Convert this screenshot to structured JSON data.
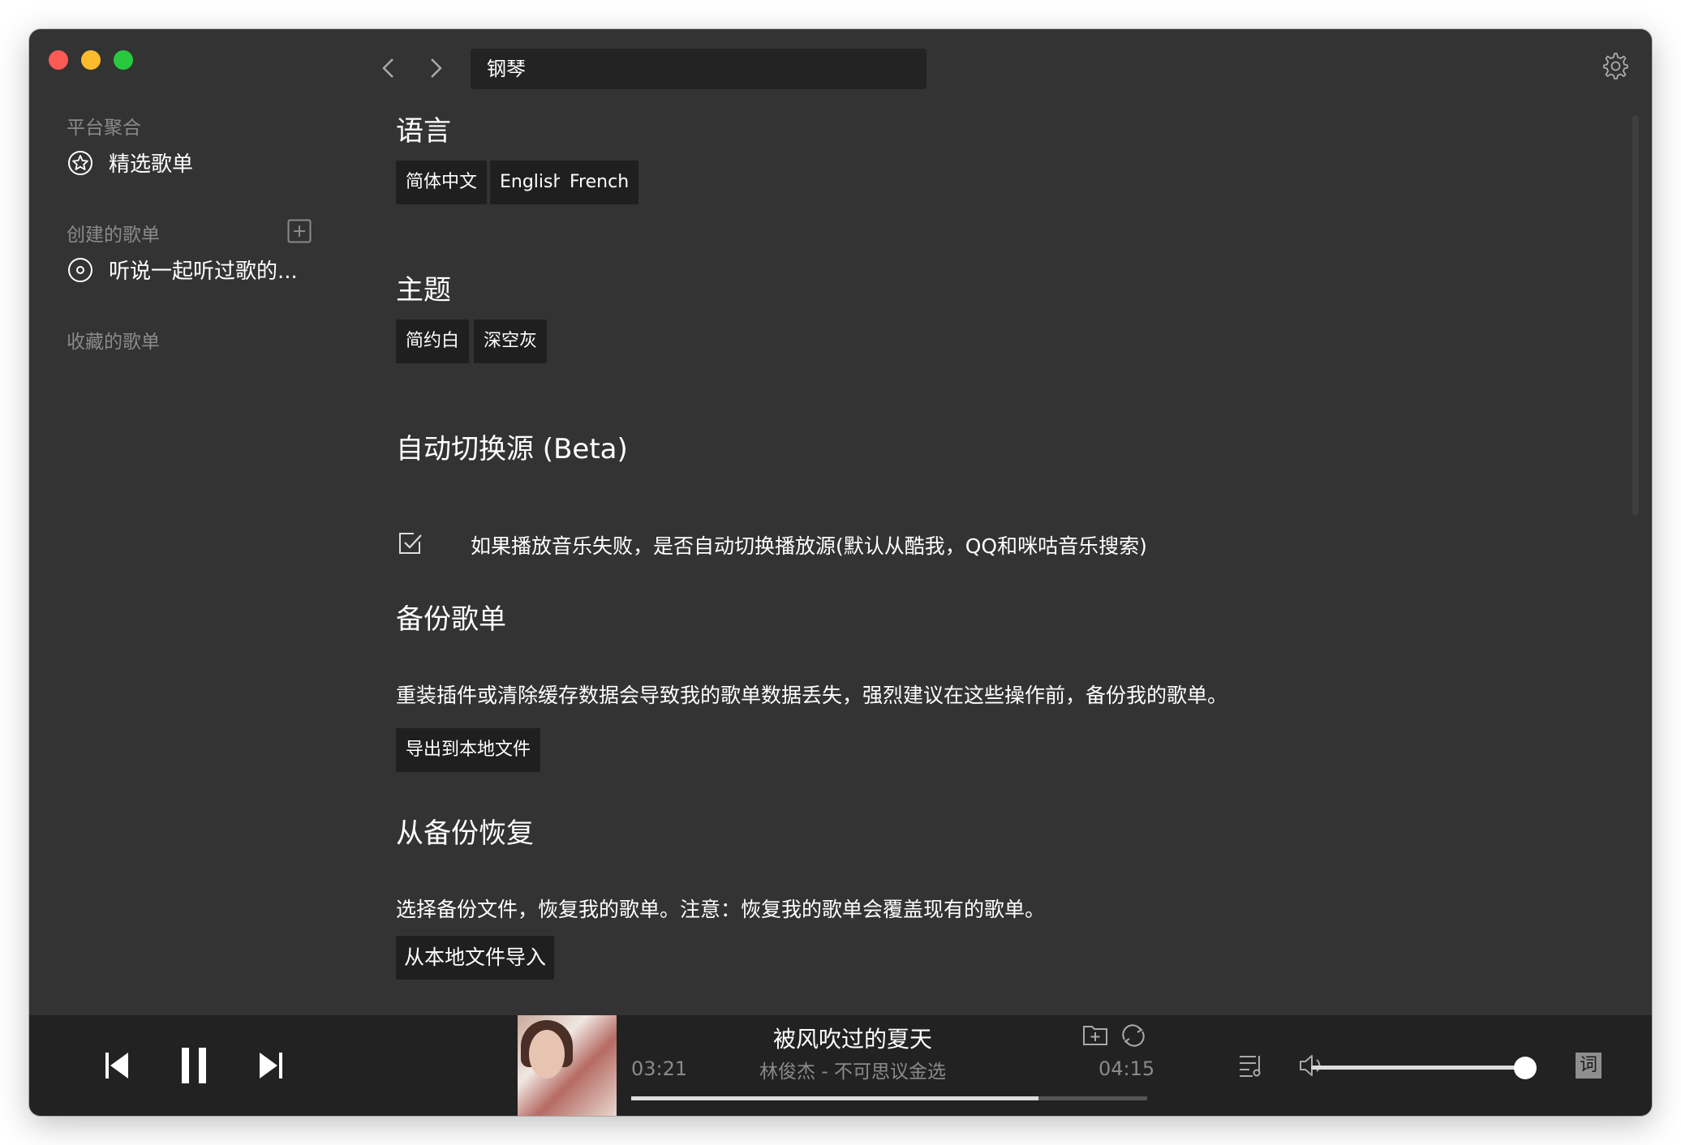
{
  "search": {
    "value": "钢琴"
  },
  "sidebar": {
    "platform_section": "平台聚合",
    "featured_label": "精选歌单",
    "created_section": "创建的歌单",
    "created_items": [
      "听说一起听过歌的..."
    ],
    "favorites_section": "收藏的歌单"
  },
  "settings": {
    "language": {
      "title": "语言",
      "options": [
        "简体中文",
        "English",
        "French"
      ]
    },
    "theme": {
      "title": "主题",
      "options": [
        "简约白",
        "深空灰"
      ]
    },
    "auto_switch": {
      "title": "自动切换源 (Beta)",
      "checkbox_label": "如果播放音乐失败，是否自动切换播放源(默认从酷我，QQ和咪咕音乐搜索)",
      "checked": true
    },
    "backup": {
      "title": "备份歌单",
      "description": "重装插件或清除缓存数据会导致我的歌单数据丢失，强烈建议在这些操作前，备份我的歌单。",
      "button": "导出到本地文件"
    },
    "restore": {
      "title": "从备份恢复",
      "description": "选择备份文件，恢复我的歌单。注意：恢复我的歌单会覆盖现有的歌单。",
      "button": "从本地文件导入"
    }
  },
  "player": {
    "title": "被风吹过的夏天",
    "artist_album": "林俊杰 - 不可思议金选",
    "current_time": "03:21",
    "total_time": "04:15",
    "progress": 0.79,
    "volume": 1.0,
    "lyric_button": "词"
  },
  "icons": [
    "star-icon",
    "disc-icon",
    "add-icon",
    "back-icon",
    "forward-icon",
    "gear-icon",
    "checkbox-icon",
    "prev-icon",
    "pause-icon",
    "next-icon",
    "add-to-playlist-icon",
    "repeat-icon",
    "playlist-icon",
    "volume-icon"
  ]
}
